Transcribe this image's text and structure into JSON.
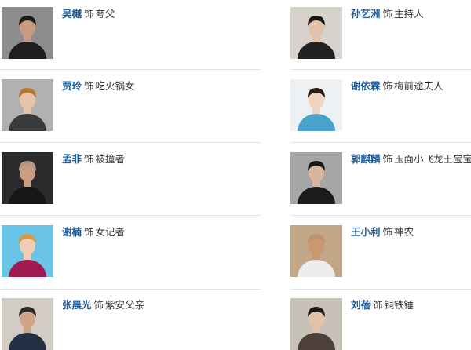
{
  "cast": {
    "items": [
      {
        "actor": "吴樾",
        "as": "饰",
        "role": "夸父",
        "photo": {
          "bg": "#8d8d8d",
          "skin": "#c89a82",
          "hair": "#1a1a1a",
          "cloth": "#1e1e1e"
        }
      },
      {
        "actor": "孙艺洲",
        "as": "饰",
        "role": "主持人",
        "photo": {
          "bg": "#d7d2cc",
          "skin": "#e2c2aa",
          "hair": "#1a1410",
          "cloth": "#222222"
        }
      },
      {
        "actor": "贾玲",
        "as": "饰",
        "role": "吃火锅女",
        "photo": {
          "bg": "#b1b1b1",
          "skin": "#e6c4a9",
          "hair": "#b9772f",
          "cloth": "#3a3a3a"
        }
      },
      {
        "actor": "谢依霖",
        "as": "饰",
        "role": "梅前途夫人",
        "photo": {
          "bg": "#eef1f4",
          "skin": "#efd4c2",
          "hair": "#2a1e18",
          "cloth": "#49a2ca"
        }
      },
      {
        "actor": "孟非",
        "as": "饰",
        "role": "被撞者",
        "photo": {
          "bg": "#2b2b2b",
          "skin": "#c89e83",
          "hair": "#b79a86",
          "cloth": "#161616"
        }
      },
      {
        "actor": "郭麒麟",
        "as": "饰",
        "role": "玉面小飞龙王宝宝",
        "photo": {
          "bg": "#a6a6a6",
          "skin": "#d8b59c",
          "hair": "#161616",
          "cloth": "#1b1b1b"
        }
      },
      {
        "actor": "谢楠",
        "as": "饰",
        "role": "女记者",
        "photo": {
          "bg": "#69c4e6",
          "skin": "#f0cdb4",
          "hair": "#d39b49",
          "cloth": "#a01c52"
        }
      },
      {
        "actor": "王小利",
        "as": "饰",
        "role": "神农",
        "photo": {
          "bg": "#c2a688",
          "skin": "#c99870",
          "hair": "#bf9270",
          "cloth": "#ececec"
        }
      },
      {
        "actor": "张晨光",
        "as": "饰",
        "role": "紫安父亲",
        "photo": {
          "bg": "#d3ccc4",
          "skin": "#cfa487",
          "hair": "#2b2b2b",
          "cloth": "#222f44"
        }
      },
      {
        "actor": "刘蓓",
        "as": "饰",
        "role": "铜铁锤",
        "photo": {
          "bg": "#c8c1b8",
          "skin": "#e3c2a8",
          "hair": "#1e1a18",
          "cloth": "#4d3f39"
        }
      }
    ]
  }
}
